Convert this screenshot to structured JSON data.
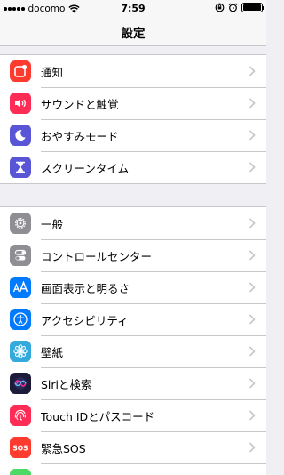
{
  "status_bar": {
    "carrier": "docomo",
    "time": "7:59"
  },
  "nav": {
    "title": "設定"
  },
  "groups": [
    {
      "items": [
        {
          "label": "通知",
          "icon": "notifications-icon",
          "color": "#ff3b30"
        },
        {
          "label": "サウンドと触覚",
          "icon": "speaker-icon",
          "color": "#ff2d55"
        },
        {
          "label": "おやすみモード",
          "icon": "moon-icon",
          "color": "#5856d6"
        },
        {
          "label": "スクリーンタイム",
          "icon": "hourglass-icon",
          "color": "#5856d6"
        }
      ]
    },
    {
      "items": [
        {
          "label": "一般",
          "icon": "gear-icon",
          "color": "#8e8e93"
        },
        {
          "label": "コントロールセンター",
          "icon": "toggles-icon",
          "color": "#8e8e93"
        },
        {
          "label": "画面表示と明るさ",
          "icon": "text-size-icon",
          "color": "#007aff"
        },
        {
          "label": "アクセシビリティ",
          "icon": "accessibility-icon",
          "color": "#007aff"
        },
        {
          "label": "壁紙",
          "icon": "wallpaper-flower-icon",
          "color": "#34aadc"
        },
        {
          "label": "Siriと検索",
          "icon": "siri-icon",
          "color": "#1c1c3a"
        },
        {
          "label": "Touch IDとパスコード",
          "icon": "fingerprint-icon",
          "color": "#ff2d55"
        },
        {
          "label": "緊急SOS",
          "icon": "sos-icon",
          "color": "#ff3b30"
        }
      ]
    }
  ]
}
